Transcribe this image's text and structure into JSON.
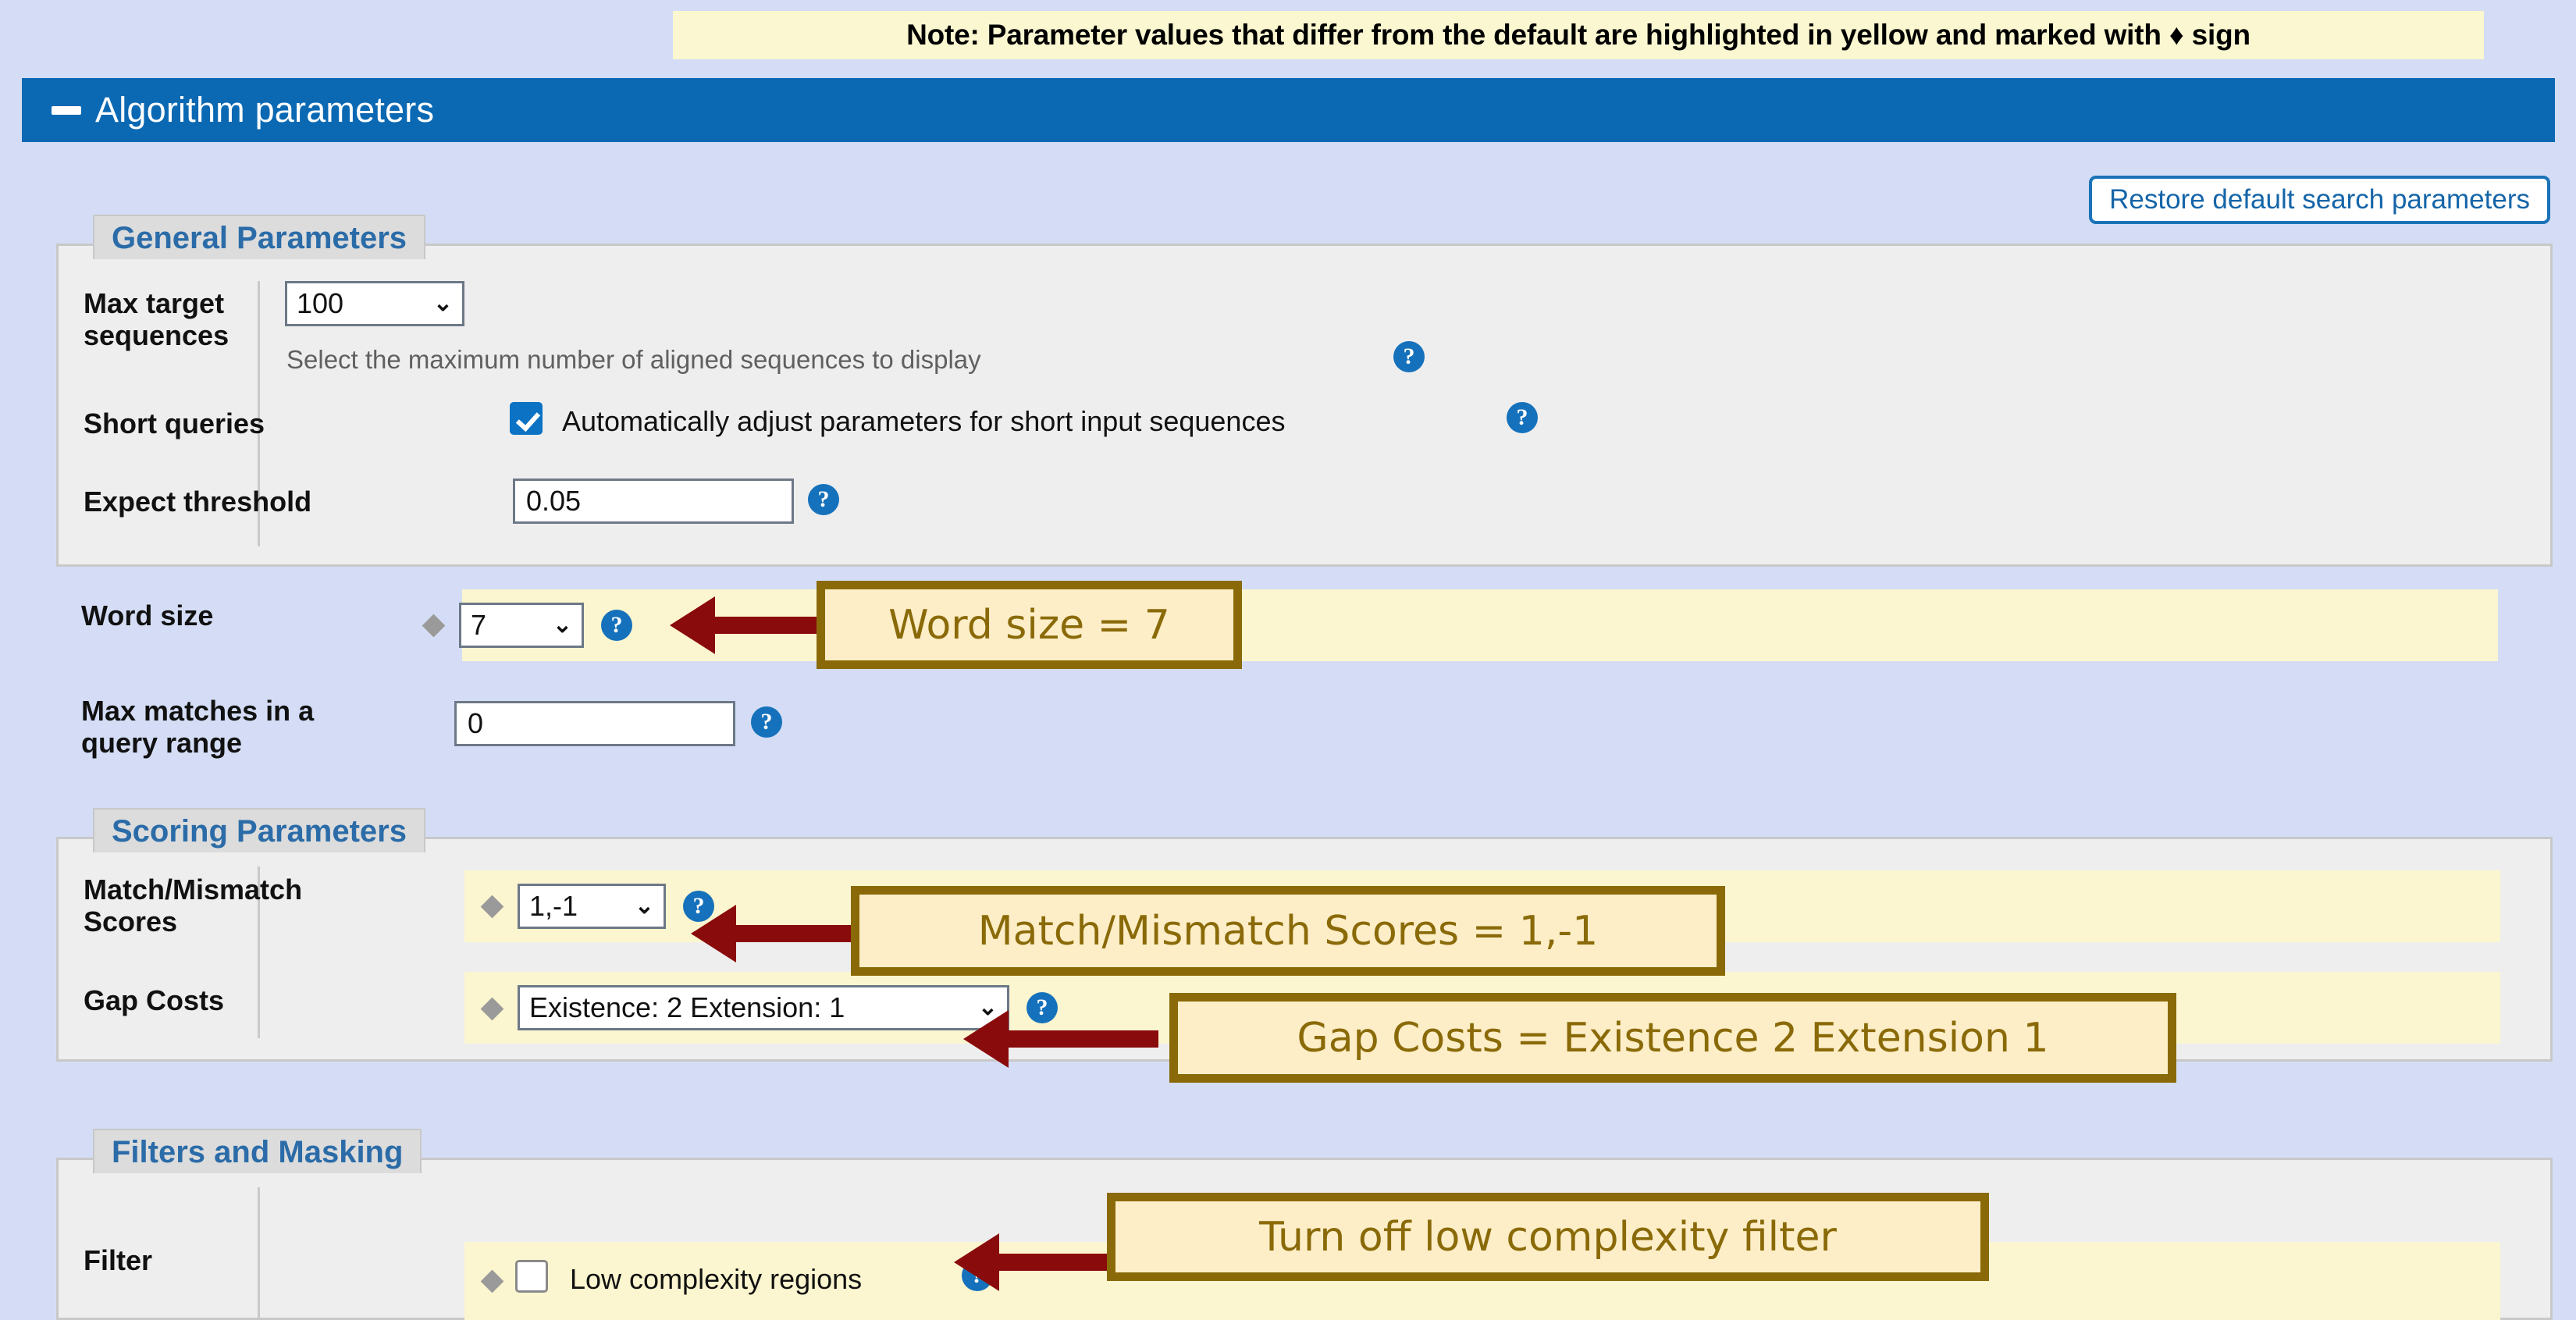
{
  "note": {
    "text": "Note: Parameter values that differ from the default are highlighted in yellow and marked with ♦ sign"
  },
  "header": {
    "title": "Algorithm parameters",
    "collapse_icon": "minus-icon"
  },
  "toolbar": {
    "restore_label": "Restore default search parameters"
  },
  "sections": {
    "general": {
      "legend": "General Parameters",
      "max_target_sequences": {
        "label": "Max target\nsequences",
        "value": "100",
        "helper": "Select the maximum number of aligned sequences to display",
        "help_icon": "question-mark-icon"
      },
      "short_queries": {
        "label": "Short queries",
        "checkbox_label": "Automatically adjust parameters for short input sequences",
        "checked": true,
        "help_icon": "question-mark-icon"
      },
      "expect_threshold": {
        "label": "Expect threshold",
        "value": "0.05",
        "help_icon": "question-mark-icon"
      },
      "word_size": {
        "label": "Word size",
        "value": "7",
        "modified": true,
        "modified_marker": "♦",
        "help_icon": "question-mark-icon"
      },
      "max_matches": {
        "label": "Max matches in a\nquery range",
        "value": "0",
        "help_icon": "question-mark-icon"
      }
    },
    "scoring": {
      "legend": "Scoring Parameters",
      "match_mismatch": {
        "label": "Match/Mismatch\nScores",
        "value": "1,-1",
        "modified": true,
        "modified_marker": "♦",
        "help_icon": "question-mark-icon"
      },
      "gap_costs": {
        "label": "Gap Costs",
        "value": "Existence: 2 Extension: 1",
        "modified": true,
        "modified_marker": "♦",
        "help_icon": "question-mark-icon"
      }
    },
    "filters": {
      "legend": "Filters and Masking",
      "filter": {
        "label": "Filter",
        "checkbox_label": "Low complexity regions",
        "checked": false,
        "modified": true,
        "modified_marker": "♦",
        "help_icon": "question-mark-icon"
      }
    }
  },
  "callouts": [
    {
      "id": "word-size",
      "text": "Word size = 7"
    },
    {
      "id": "match-mismatch",
      "text": "Match/Mismatch Scores = 1,-1"
    },
    {
      "id": "gap-costs",
      "text": "Gap Costs = Existence 2 Extension 1"
    },
    {
      "id": "filter",
      "text": "Turn off low complexity filter"
    }
  ],
  "colors": {
    "header_blue": "#0b69b3",
    "page_blue": "#d4ddf5",
    "highlight_yellow": "#fbf6cf",
    "callout_border": "#8a6a08",
    "arrow_red": "#8a0b0b",
    "legend_blue": "#2b6ca8"
  }
}
